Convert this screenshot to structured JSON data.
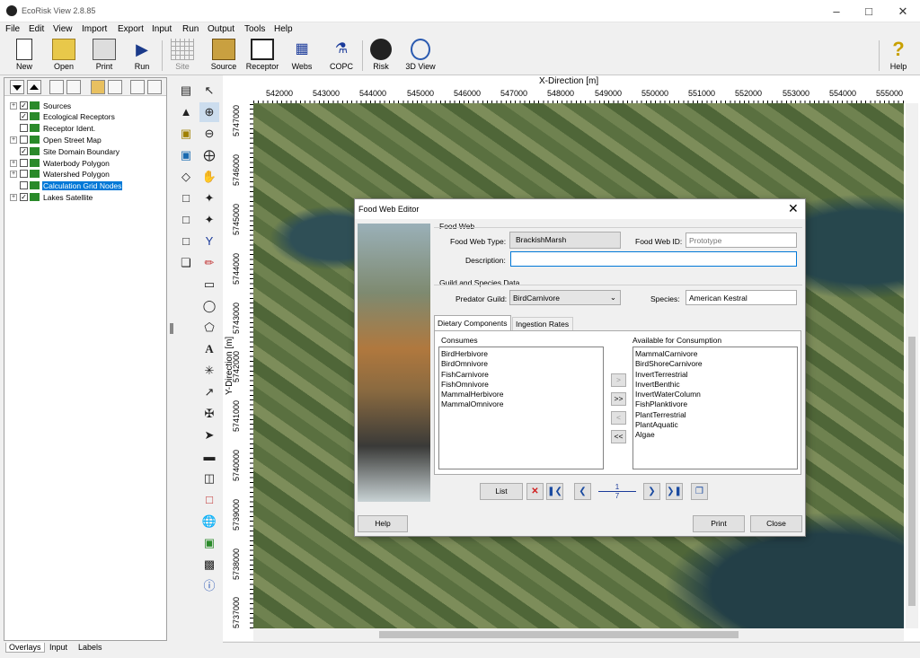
{
  "window": {
    "title": "EcoRisk View 2.8.85"
  },
  "menu": [
    "File",
    "Edit",
    "View",
    "Import",
    "Export",
    "Input",
    "Run",
    "Output",
    "Tools",
    "Help"
  ],
  "toolbar": {
    "new": "New",
    "open": "Open",
    "print": "Print",
    "run": "Run",
    "site": "Site",
    "source": "Source",
    "receptor": "Receptor",
    "webs": "Webs",
    "copc": "COPC",
    "risk": "Risk",
    "view3d": "3D View",
    "help": "Help"
  },
  "layers": [
    {
      "label": "Sources",
      "expander": "+",
      "checked": true
    },
    {
      "label": "Ecological Receptors",
      "expander": "",
      "checked": true
    },
    {
      "label": "Receptor Ident.",
      "expander": "",
      "checked": false
    },
    {
      "label": "Open Street Map",
      "expander": "+",
      "checked": false
    },
    {
      "label": "Site Domain Boundary",
      "expander": "",
      "checked": true
    },
    {
      "label": "Waterbody Polygon",
      "expander": "+",
      "checked": false
    },
    {
      "label": "Watershed Polygon",
      "expander": "+",
      "checked": false
    },
    {
      "label": "Calculation Grid Nodes",
      "expander": "",
      "checked": false
    },
    {
      "label": "Lakes Satellite",
      "expander": "+",
      "checked": true
    }
  ],
  "left_tabs": [
    "Overlays",
    "Input",
    "Labels"
  ],
  "map": {
    "x_title": "X-Direction [m]",
    "y_title": "Y-Direction [m]",
    "x_ticks": [
      "542000",
      "543000",
      "544000",
      "545000",
      "546000",
      "547000",
      "548000",
      "549000",
      "550000",
      "551000",
      "552000",
      "553000",
      "554000",
      "555000"
    ],
    "y_ticks": [
      "5747000",
      "5746000",
      "5745000",
      "5744000",
      "5743000",
      "5742000",
      "5741000",
      "5740000",
      "5739000",
      "5738000",
      "5737000"
    ]
  },
  "dialog": {
    "title": "Food Web Editor",
    "food_web_group": "Food Web",
    "type_label": "Food Web Type:",
    "type_value": "BrackishMarsh",
    "id_label": "Food Web ID:",
    "id_placeholder": "Prototype",
    "description_label": "Description:",
    "description_value": "",
    "guild_group": "Guild and Species Data",
    "predator_label": "Predator Guild:",
    "predator_value": "BirdCarnivore",
    "species_label": "Species:",
    "species_value": "American Kestral",
    "tab_dietary": "Dietary Components",
    "tab_ingestion": "Ingestion Rates",
    "consumes_label": "Consumes",
    "available_label": "Available for Consumption",
    "consumes": [
      "BirdHerbivore",
      "BirdOmnivore",
      "FishCarnivore",
      "FishOmnivore",
      "MammalHerbivore",
      "MammalOmnivore"
    ],
    "available": [
      "MammalCarnivore",
      "BirdShoreCarnivore",
      "InvertTerrestrial",
      "InvertBenthic",
      "InvertWaterColumn",
      "FishPlanktivore",
      "PlantTerrestrial",
      "PlantAquatic",
      "Algae"
    ],
    "move_one_right": ">",
    "move_all_right": ">>",
    "move_one_left": "<",
    "move_all_left": "<<",
    "list_btn": "List",
    "page_current": "1",
    "page_total": "7",
    "help_btn": "Help",
    "print_btn": "Print",
    "close_btn": "Close"
  }
}
